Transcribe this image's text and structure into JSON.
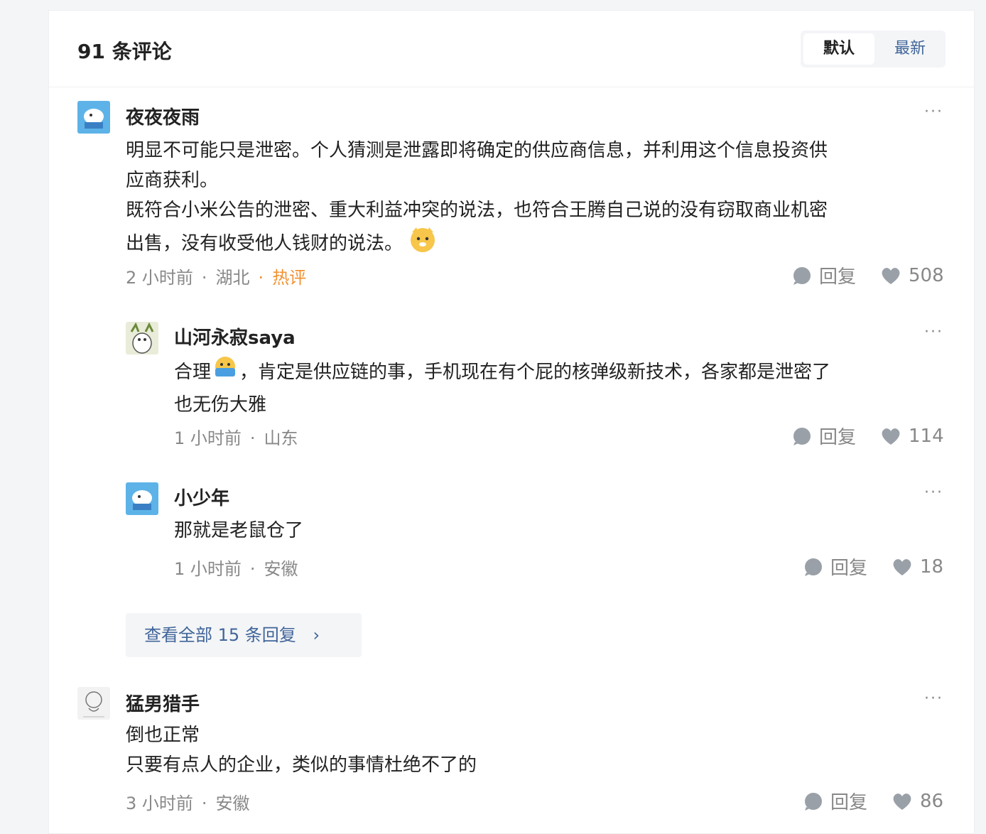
{
  "header": {
    "count_title": "91 条评论",
    "sort_default": "默认",
    "sort_latest": "最新"
  },
  "colors": {
    "link": "#406599",
    "hot": "#f29131",
    "meta": "#888888"
  },
  "comments": [
    {
      "user": "夜夜夜雨",
      "lines": [
        "明显不可能只是泄密。个人猜测是泄露即将确定的供应商信息，并利用这个信息投资供",
        "应商获利。",
        "既符合小米公告的泄密、重大利益冲突的说法，也符合王腾自己说的没有窃取商业机密",
        "出售，没有收受他人钱财的说法。"
      ],
      "time": "2 小时前",
      "location": "湖北",
      "tag": "热评",
      "reply_label": "回复",
      "likes": "508"
    },
    {
      "user": "山河永寂saya",
      "lines": [
        "合理",
        "，肯定是供应链的事，手机现在有个屁的核弹级新技术，各家都是泄密了",
        "也无伤大雅"
      ],
      "time": "1 小时前",
      "location": "山东",
      "reply_label": "回复",
      "likes": "114"
    },
    {
      "user": "小少年",
      "lines": [
        "那就是老鼠仓了"
      ],
      "time": "1 小时前",
      "location": "安徽",
      "reply_label": "回复",
      "likes": "18"
    },
    {
      "user": "猛男猎手",
      "lines": [
        "倒也正常",
        "只要有点人的企业，类似的事情杜绝不了的"
      ],
      "time": "3 小时前",
      "location": "安徽",
      "reply_label": "回复",
      "likes": "86"
    }
  ],
  "view_all": {
    "label": "查看全部 15 条回复",
    "chevron": "›"
  },
  "more_glyph": "···"
}
